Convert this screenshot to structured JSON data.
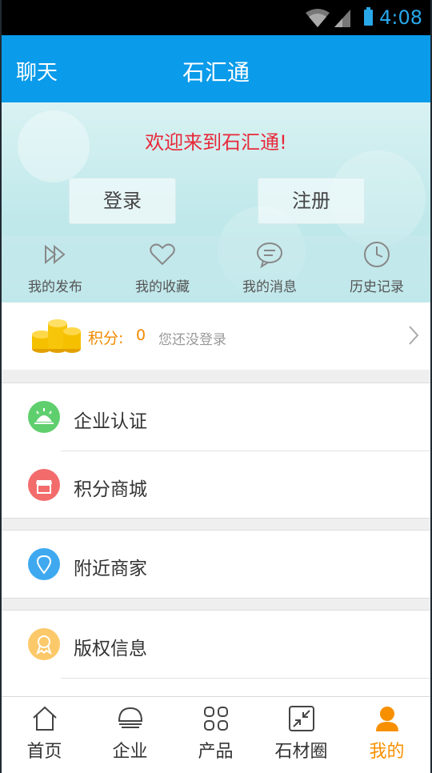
{
  "status": {
    "time": "4:08"
  },
  "header": {
    "left": "聊天",
    "title": "石汇通"
  },
  "banner": {
    "welcome": "欢迎来到石汇通!",
    "login": "登录",
    "register": "注册",
    "quick": [
      "我的发布",
      "我的收藏",
      "我的消息",
      "历史记录"
    ]
  },
  "points": {
    "label": "积分:",
    "value": "0",
    "hint": "您还没登录"
  },
  "menu": {
    "cert": "企业认证",
    "mall": "积分商城",
    "nearby": "附近商家",
    "copyright": "版权信息"
  },
  "tabs": [
    "首页",
    "企业",
    "产品",
    "石材圈",
    "我的"
  ],
  "colors": {
    "accent": "#0a9bea",
    "active_tab": "#f79000",
    "welcome": "#e8293a"
  }
}
